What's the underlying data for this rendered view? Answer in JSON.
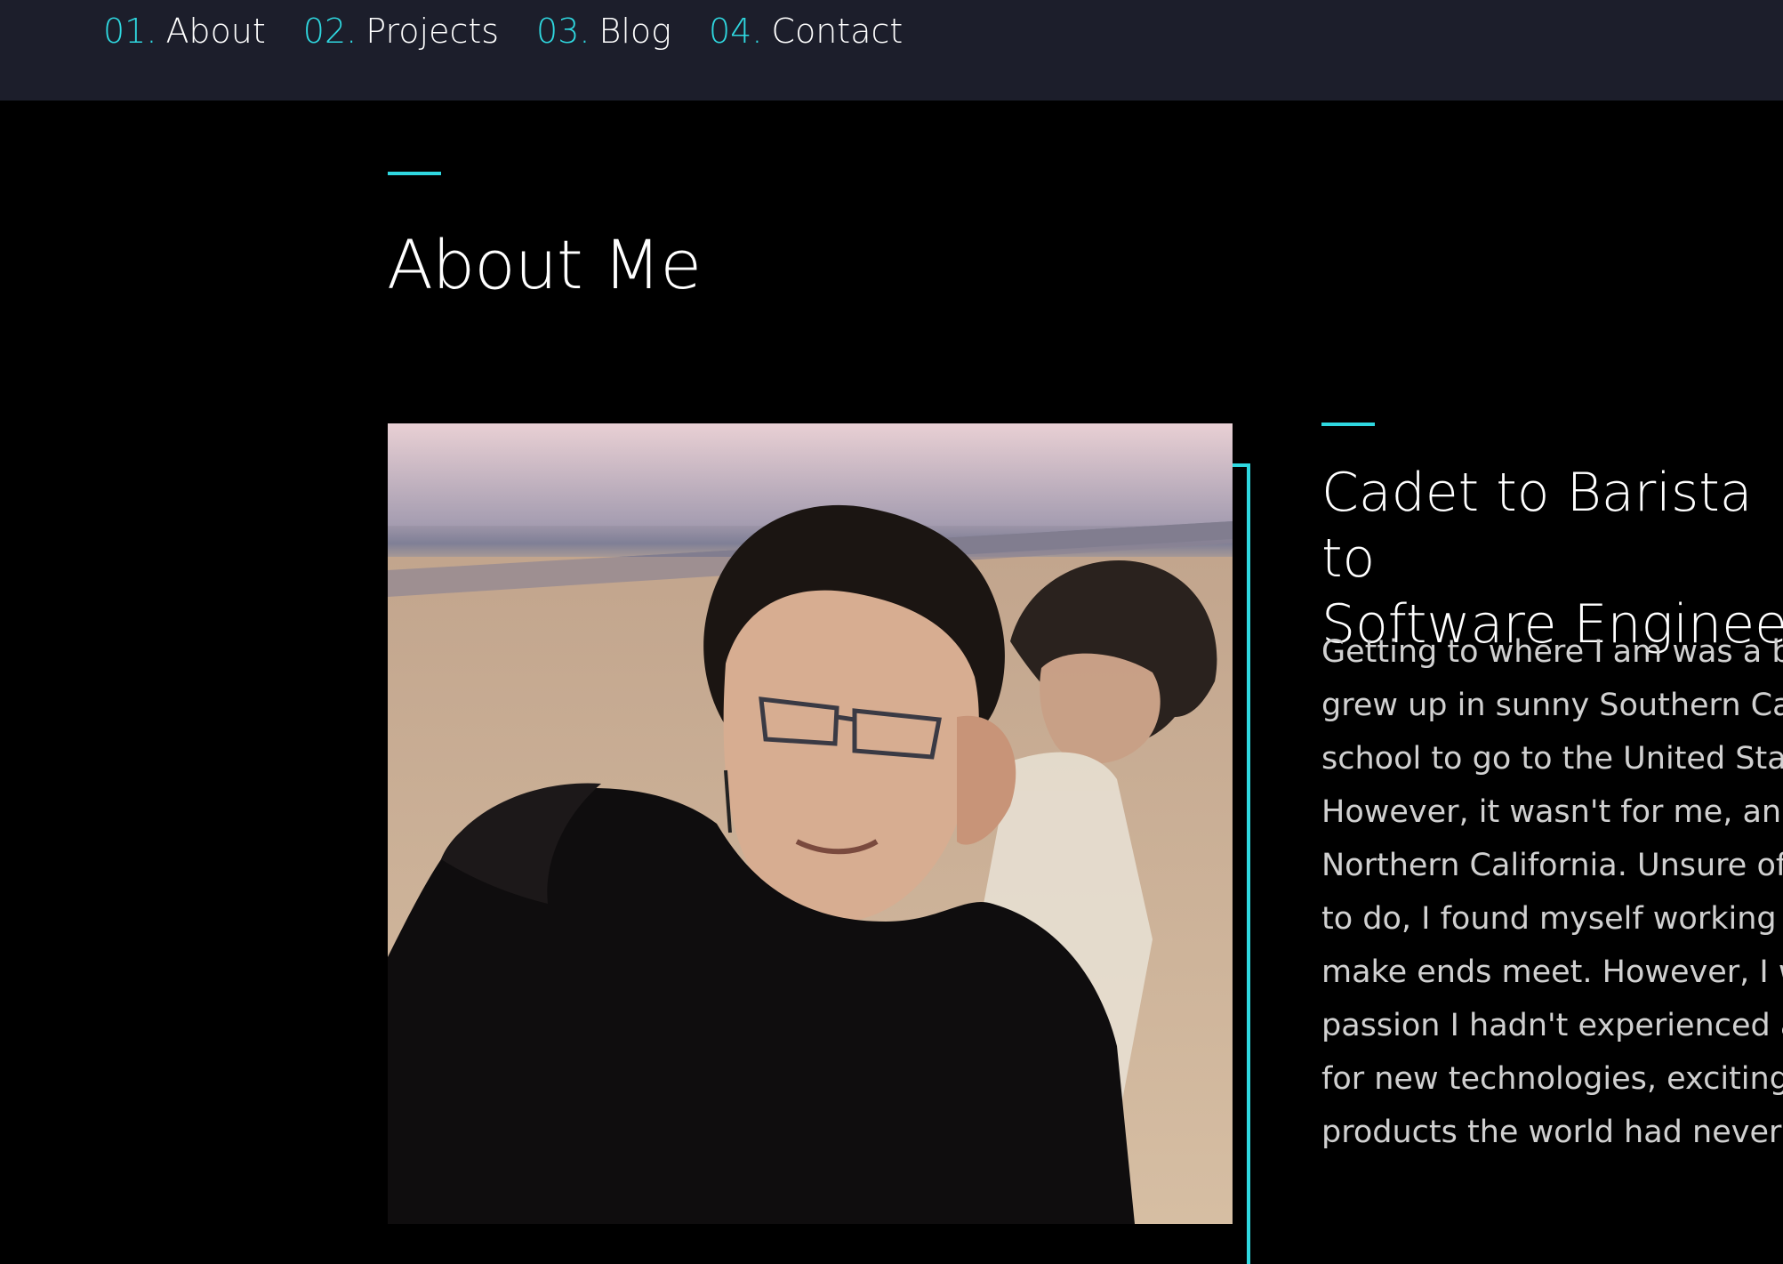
{
  "nav": {
    "items": [
      {
        "number": "01.",
        "label": "About"
      },
      {
        "number": "02.",
        "label": "Projects"
      },
      {
        "number": "03.",
        "label": "Blog"
      },
      {
        "number": "04.",
        "label": "Contact"
      }
    ]
  },
  "about": {
    "section_title": "About Me",
    "subtitle": "Cadet to Barista to\nSoftware Engineer",
    "body": "Getting to where I am was a bi\ngrew up in sunny Southern Ca\nschool to go to the United Sta\nHowever, it wasn't for me, and\nNorthern California. Unsure of\nto do, I found myself working c\nmake ends meet. However, I w\npassion I hadn't experienced a\nfor new technologies, exciting\nproducts the world had never"
  },
  "colors": {
    "accent": "#2fd8e0",
    "nav_background": "#1c1e2b",
    "page_background": "#000000",
    "text": "#ffffff"
  }
}
